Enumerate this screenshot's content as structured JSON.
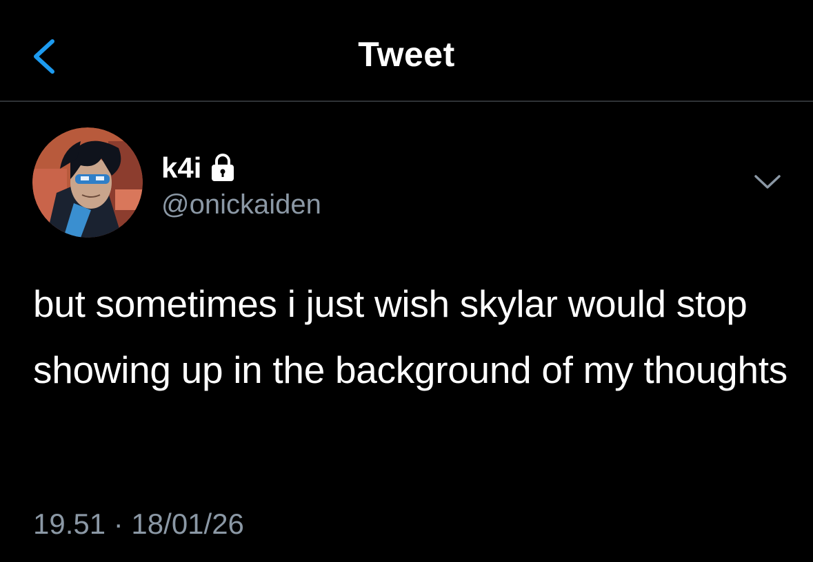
{
  "colors": {
    "background": "#000000",
    "accent": "#1d9bf0",
    "text_primary": "#ffffff",
    "text_secondary": "#8b98a5",
    "divider": "#2f3336"
  },
  "header": {
    "back_icon": "chevron-left-icon",
    "title": "Tweet"
  },
  "tweet": {
    "author": {
      "display_name": "k4i",
      "protected_icon": "lock-icon",
      "handle": "@onickaiden",
      "avatar_icon": "avatar-illustration"
    },
    "more_icon": "chevron-down-icon",
    "text": "but sometimes i just wish skylar would stop showing up in the background of my thoughts",
    "timestamp": "19.51 · 18/01/26"
  }
}
